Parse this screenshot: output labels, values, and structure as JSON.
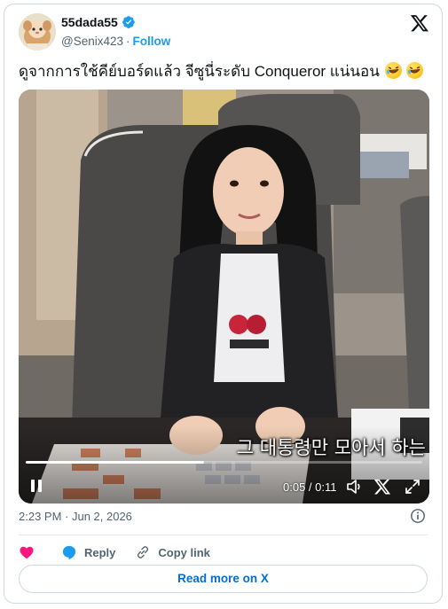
{
  "author": {
    "display_name": "55dada55",
    "handle": "@Senix423",
    "separator": "·",
    "follow_label": "Follow",
    "verified": true
  },
  "tweet": {
    "text": "ดูจากการใช้คีย์บอร์ดแล้ว จีซูนี่ระดับ Conqueror แน่นอน",
    "emojis": [
      "rolling-on-floor-laughing",
      "rolling-on-floor-laughing"
    ]
  },
  "video": {
    "subtitle": "그 대통령만 모아서 하는",
    "time_display": "0:05 / 0:11",
    "progress_fraction": 0.45,
    "state": "paused-icon-visible"
  },
  "meta": {
    "timestamp": "2:23 PM · Jun 2, 2026"
  },
  "actions": {
    "like_label": "",
    "reply_label": "Reply",
    "copy_link_label": "Copy link"
  },
  "footer": {
    "read_more_label": "Read more on X"
  },
  "colors": {
    "accent": "#1d9bf0",
    "link": "#006fd6",
    "heart": "#f91880",
    "text": "#0f1419",
    "secondary": "#536471"
  }
}
